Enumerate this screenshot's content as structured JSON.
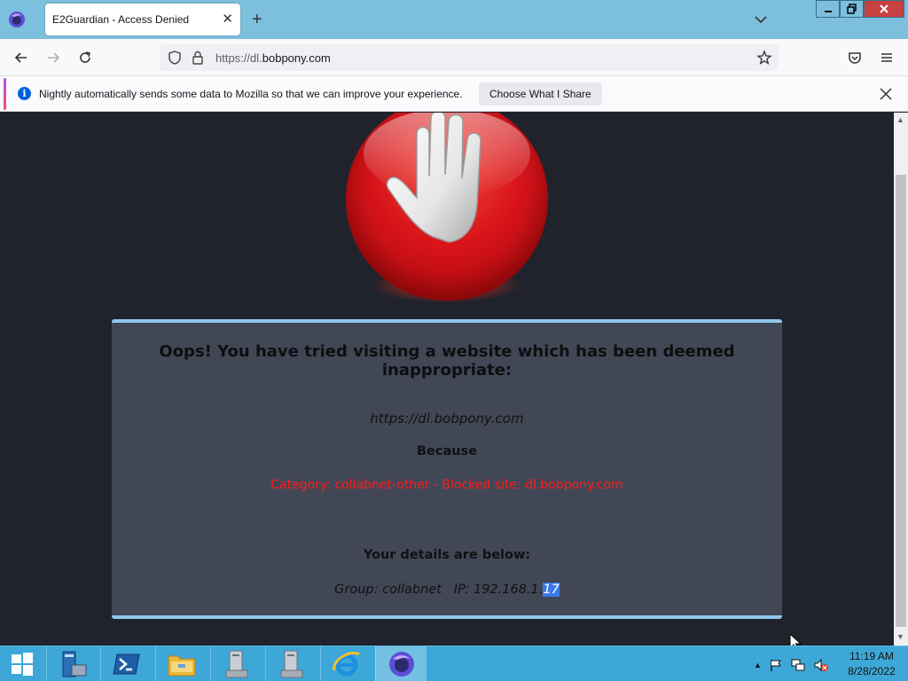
{
  "browser": {
    "tab_title": "E2Guardian - Access Denied",
    "url_prefix": "https://dl.",
    "url_host": "bobpony.com"
  },
  "notification": {
    "message": "Nightly automatically sends some data to Mozilla so that we can improve your experience.",
    "button_label": "Choose What I Share"
  },
  "page": {
    "heading": "Oops! You have tried visiting a website which has been deemed inappropriate:",
    "blocked_url": "https://dl.bobpony.com",
    "because_label": "Because",
    "reason": "Category: collabnet-other - Blocked site: dl.bobpony.com",
    "details_label": "Your details are below:",
    "group_prefix": "Group: collabnet   IP: 192.168.1.",
    "group_selected": "17"
  },
  "taskbar": {
    "time": "11:19 AM",
    "date": "8/28/2022"
  },
  "colors": {
    "tab_bar": "#7cc0de",
    "page_background": "#20232b",
    "panel": "#424756",
    "panel_border": "#8fc8ec",
    "reason_text": "#ff1a1a",
    "taskbar": "#3da8d8"
  },
  "icons": [
    "firefox-nightly-icon",
    "tab-close-icon",
    "new-tab-icon",
    "tab-list-icon",
    "back-icon",
    "forward-icon",
    "reload-icon",
    "shield-icon",
    "lock-icon",
    "bookmark-star-icon",
    "pocket-icon",
    "menu-icon",
    "info-icon",
    "close-icon",
    "stop-hand-icon",
    "windows-start-icon",
    "server-manager-icon",
    "powershell-icon",
    "file-explorer-icon",
    "internet-explorer-icon",
    "firefox-icon"
  ]
}
